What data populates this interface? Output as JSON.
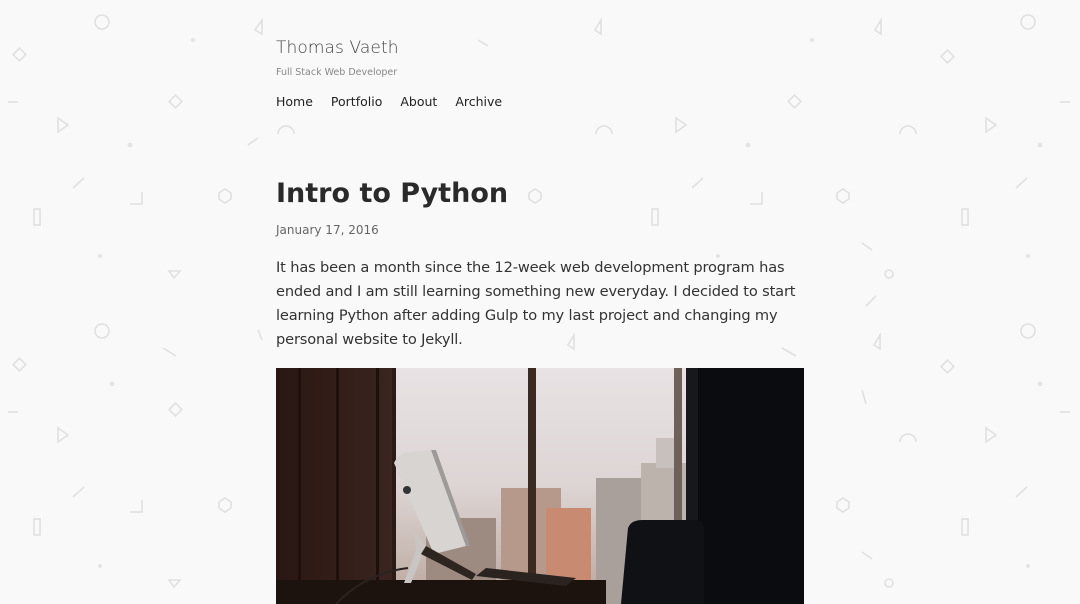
{
  "site": {
    "title": "Thomas Vaeth",
    "tagline": "Full Stack Web Developer"
  },
  "nav": {
    "items": [
      {
        "label": "Home"
      },
      {
        "label": "Portfolio"
      },
      {
        "label": "About"
      },
      {
        "label": "Archive"
      }
    ]
  },
  "post": {
    "title": "Intro to Python",
    "date": "January 17, 2016",
    "body": "It has been a month since the 12-week web development program has ended and I am still learning something new everyday. I decided to start learning Python after adding Gulp to my last project and changing my personal website to Jekyll."
  },
  "colors": {
    "background": "#f9f9f9",
    "pattern": "#e2e2e2",
    "title_text": "#2a2a2a",
    "body_text": "#333333"
  }
}
